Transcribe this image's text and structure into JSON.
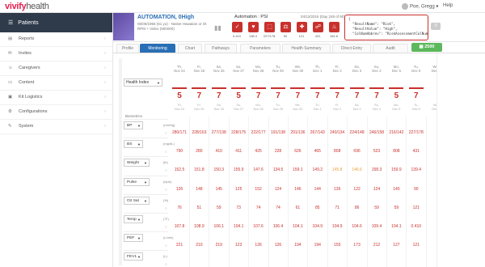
{
  "app": {
    "logo_main": "vivify",
    "logo_sub": "health",
    "user": "Poe, Gregg",
    "help": "Help"
  },
  "sidebar": {
    "header": "Patients",
    "items": [
      {
        "label": "Reports",
        "icon": "chart-icon"
      },
      {
        "label": "Invites",
        "icon": "mail-icon"
      },
      {
        "label": "Caregivers",
        "icon": "people-icon"
      },
      {
        "label": "Content",
        "icon": "folder-icon"
      },
      {
        "label": "Kit Logistics",
        "icon": "box-icon"
      },
      {
        "label": "Configurations",
        "icon": "gear-icon"
      },
      {
        "label": "System",
        "icon": "wrench-icon"
      }
    ]
  },
  "patient": {
    "name": "AUTOMATION, 0High",
    "info": "05/05/1955 (61 yo) · Native Hawaiian or Ot",
    "info2": "RPM + Video (900000)",
    "automation": "Automation : PSI",
    "date": "04/12/2016 (Day 249 of 90)",
    "tile_values": [
      "0.410",
      "138.4",
      "227/178",
      "90",
      "121",
      "431",
      "164.6"
    ],
    "json": "{\n  \"ResultName\": \"Risk\",\n  \"ResultValue\": \"High\",\n  \"ColNumAbbrev\": \"RiskAssessmentColNumA\""
  },
  "tabs": [
    "Profile",
    "Monitoring",
    "Chart",
    "Pathways",
    "Parameters",
    "Health Summary",
    "Direct Entry",
    "Audit"
  ],
  "score": "2500",
  "health_index": "Health Index",
  "biometrics_title": "Biometrics",
  "dates": [
    {
      "d": "Th,",
      "m": "Nov 24",
      "s": "Nov 24"
    },
    {
      "d": "Fr,",
      "m": "Nov 25",
      "s": "Nov 25"
    },
    {
      "d": "Sa,",
      "m": "Nov 26",
      "s": "Nov 26"
    },
    {
      "d": "Su,",
      "m": "Nov 27",
      "s": "Nov 27"
    },
    {
      "d": "Mo,",
      "m": "Nov 28",
      "s": "Nov 28"
    },
    {
      "d": "Tu,",
      "m": "Nov 29",
      "s": "Nov 29"
    },
    {
      "d": "We,",
      "m": "Nov 30",
      "s": "Nov 30"
    },
    {
      "d": "Th,",
      "m": "Dec 1",
      "s": "Dec 1"
    },
    {
      "d": "Fr,",
      "m": "Dec 2",
      "s": "Dec 2"
    },
    {
      "d": "Sa,",
      "m": "Dec 3",
      "s": "Dec 3"
    },
    {
      "d": "Su,",
      "m": "Dec 4",
      "s": "Dec 4"
    },
    {
      "d": "Mo,",
      "m": "Dec 5",
      "s": "Dec 5"
    },
    {
      "d": "Tu,",
      "m": "Dec 6",
      "s": "Dec 6"
    },
    {
      "d": "We,",
      "m": "Dec 7",
      "s": "Dec 7"
    }
  ],
  "severity": [
    "5",
    "7",
    "7",
    "5",
    "7",
    "7",
    "7",
    "7",
    "7",
    "7",
    "7",
    "5",
    "7",
    ""
  ],
  "rows": [
    {
      "label": "BP",
      "unit": "(mmHg)",
      "values": [
        "280/171",
        "228/163",
        "277/138",
        "228/175",
        "222/177",
        "191/138",
        "291/136",
        "267/143",
        "240/134",
        "224/148",
        "246/158",
        "216/142",
        "227/178",
        ""
      ]
    },
    {
      "label": "BS",
      "unit": "(mg/dL)",
      "values": [
        "790",
        "280",
        "410",
        "411",
        "425",
        "228",
        "626",
        "465",
        "808",
        "696",
        "523",
        "808",
        "431",
        ""
      ]
    },
    {
      "label": "Weight",
      "unit": "(lb)",
      "values": [
        "152.5",
        "151.8",
        "150.3",
        "155.9",
        "147.6",
        "134.5",
        "159.1",
        "149.2",
        "145.8",
        "146.6",
        "158.3",
        "159.9",
        "139.4",
        ""
      ],
      "warn": [
        8,
        9
      ]
    },
    {
      "label": "Pulse",
      "unit": "(bpm)",
      "values": [
        "126",
        "148",
        "145",
        "125",
        "152",
        "124",
        "146",
        "144",
        "136",
        "122",
        "124",
        "140",
        "90",
        ""
      ]
    },
    {
      "label": "O2 Sat",
      "unit": "(%)",
      "values": [
        "76",
        "51",
        "59",
        "73",
        "74",
        "74",
        "61",
        "85",
        "71",
        "86",
        "59",
        "59",
        "121",
        ""
      ]
    },
    {
      "label": "Temp",
      "unit": "(°F)",
      "values": [
        "107.8",
        "108.9",
        "106.1",
        "104.1",
        "107.6",
        "106.4",
        "104.1",
        "104.9",
        "104.9",
        "104.6",
        "109.4",
        "104.1",
        "0.410",
        ""
      ]
    },
    {
      "label": "PEF",
      "unit": "(L/min)",
      "values": [
        "221",
        "210",
        "219",
        "123",
        "126",
        "126",
        "194",
        "194",
        "155",
        "173",
        "212",
        "127",
        "121",
        ""
      ]
    },
    {
      "label": "FEV1",
      "unit": "(L)",
      "values": [
        "",
        "",
        "",
        "",
        "",
        "",
        "",
        "",
        "",
        "",
        "",
        "",
        "",
        ""
      ]
    }
  ]
}
